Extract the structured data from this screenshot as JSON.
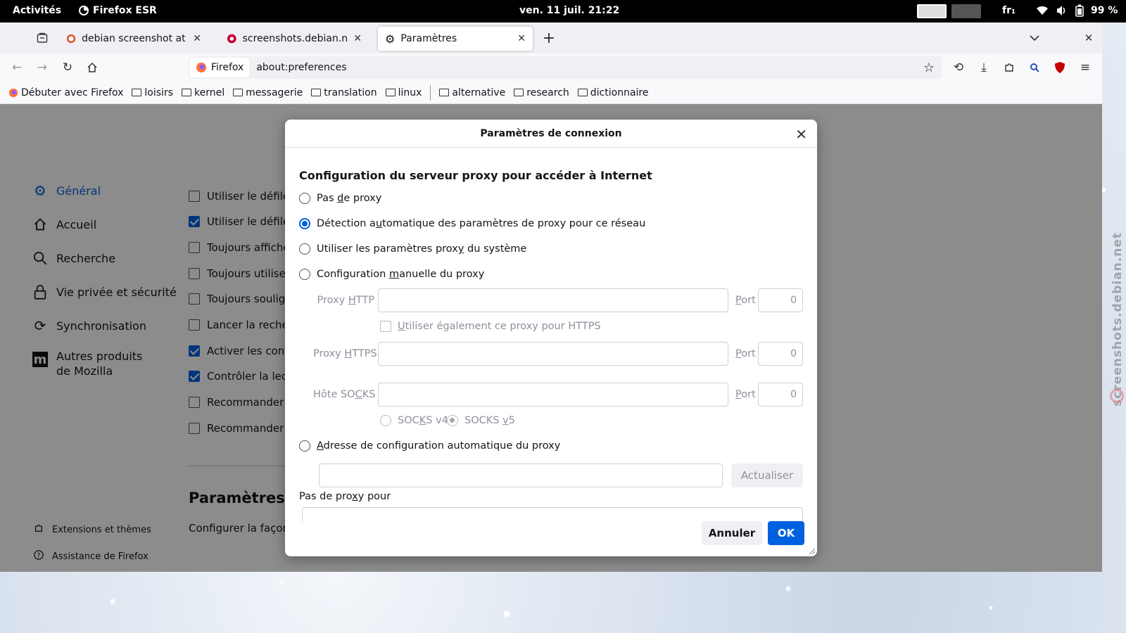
{
  "topbar": {
    "activities": "Activités",
    "app": "Firefox ESR",
    "clock": "ven. 11 juil.  21:22",
    "keyboard": "fr₁",
    "battery": "99 %"
  },
  "tabs": [
    {
      "title": "debian screenshot at Duc"
    },
    {
      "title": "screenshots.debian.net"
    },
    {
      "title": "Paramètres"
    }
  ],
  "urlbar": {
    "badge": "Firefox",
    "url": "about:preferences"
  },
  "bookmarks": [
    "Débuter avec Firefox",
    "loisirs",
    "kernel",
    "messagerie",
    "translation",
    "linux",
    "alternative",
    "research",
    "dictionnaire"
  ],
  "sidebar": {
    "items": [
      "Général",
      "Accueil",
      "Recherche",
      "Vie privée et sécurité",
      "Synchronisation",
      "Autres produits de Mozilla"
    ],
    "bottom": [
      "Extensions et thèmes",
      "Assistance de Firefox"
    ]
  },
  "prefs": {
    "rows": [
      "Utiliser le défilem",
      "Utiliser le défilem",
      "Toujours afficher",
      "Toujours utiliser l",
      "Toujours souligne",
      "Lancer la recherc",
      "Activer les contrô",
      "Contrôler la lectu",
      "Recommander de",
      "Recommander de"
    ],
    "checked": [
      false,
      true,
      false,
      false,
      false,
      false,
      true,
      true,
      false,
      false
    ],
    "section_title": "Paramètres ré",
    "section_desc": "Configurer la façon d"
  },
  "dialog": {
    "title": "Paramètres de connexion",
    "heading": "Configuration du serveur proxy pour accéder à Internet",
    "options": {
      "none_a": "Pas ",
      "none_u": "d",
      "none_b": "e proxy",
      "auto_a": "Détection a",
      "auto_u": "u",
      "auto_b": "tomatique des paramètres de proxy pour ce réseau",
      "system_a": "Utiliser les paramètres prox",
      "system_u": "y",
      "system_b": " du système",
      "manual_a": "Configuration ",
      "manual_u": "m",
      "manual_b": "anuelle du proxy",
      "pac_u": "A",
      "pac_b": "dresse de configuration automatique du proxy"
    },
    "http_lbl_a": "Proxy ",
    "http_lbl_u": "H",
    "http_lbl_b": "TTP",
    "https_lbl_a": "Proxy ",
    "https_lbl_u": "H",
    "https_lbl_b": "TTPS",
    "socks_lbl_a": "Hôte SO",
    "socks_lbl_u": "C",
    "socks_lbl_b": "KS",
    "port_u": "P",
    "port_b": "ort",
    "port_value": "0",
    "also_https_a": "U",
    "also_https_b": "tiliser également ce proxy pour HTTPS",
    "socks4_a": "SOC",
    "socks4_u": "K",
    "socks4_b": "S v4",
    "socks5_a": "SOCKS ",
    "socks5_u": "v",
    "socks5_b": "5",
    "refresh": "Actualiser",
    "no_proxy_a": "Pas de pro",
    "no_proxy_u": "x",
    "no_proxy_b": "y pour",
    "cancel": "Annuler",
    "ok": "OK"
  },
  "watermark": "screenshots.debian.net"
}
